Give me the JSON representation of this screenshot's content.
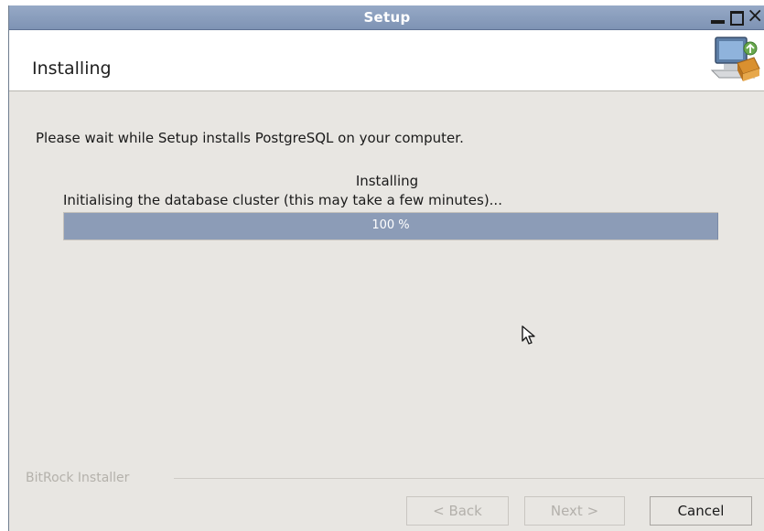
{
  "window": {
    "title": "Setup",
    "controls": {
      "minimize_icon": "minimize-icon",
      "maximize_icon": "maximize-icon",
      "close_icon": "close-icon",
      "close_glyph": "×"
    }
  },
  "header": {
    "title": "Installing",
    "icon": "installer-computer-icon"
  },
  "content": {
    "intro": "Please wait while Setup installs PostgreSQL on your computer.",
    "status_title": "Installing",
    "status_detail": "Initialising the database cluster (this may take a few minutes)...",
    "progress": {
      "fraction": 1.0,
      "label": "100 %"
    }
  },
  "footer": {
    "brand": "BitRock Installer",
    "buttons": {
      "back": "< Back",
      "next": "Next >",
      "cancel": "Cancel"
    }
  },
  "colors": {
    "titlebar": "#8a9fbf",
    "progress_fill": "#8c9cb7",
    "window_bg": "#e8e6e2"
  }
}
